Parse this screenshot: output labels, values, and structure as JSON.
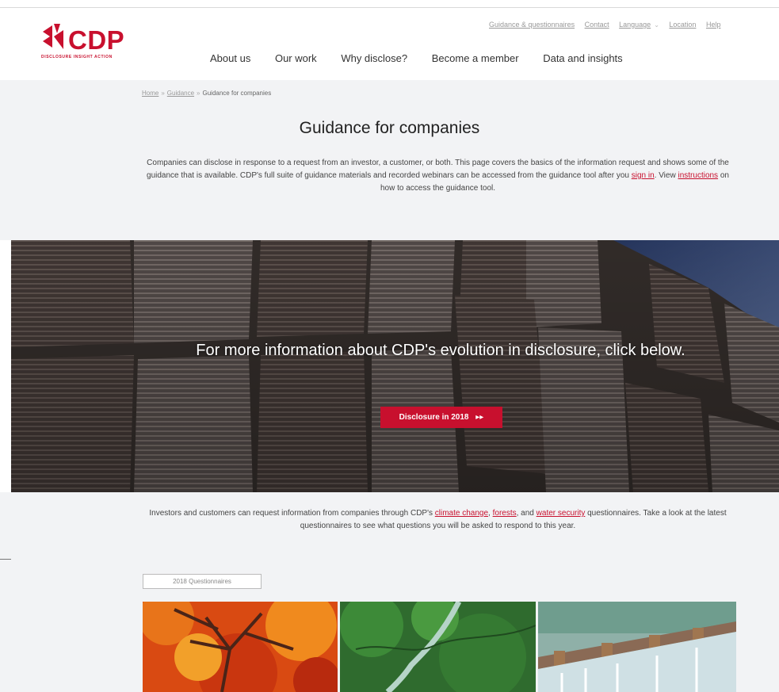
{
  "header": {
    "logo_word": "CDP",
    "logo_tagline": "DISCLOSURE INSIGHT ACTION",
    "utility_links": [
      "Guidance & questionnaires",
      "Contact",
      "Language",
      "Location",
      "Help"
    ],
    "main_nav": [
      "About us",
      "Our work",
      "Why disclose?",
      "Become a member",
      "Data and insights"
    ]
  },
  "breadcrumb": {
    "home": "Home",
    "guidance": "Guidance",
    "current": "Guidance for companies",
    "separator": "»"
  },
  "page": {
    "title": "Guidance for companies",
    "intro_before": "Companies can disclose in response to a request from an investor, a customer, or both. This page covers the basics of the information request and shows some of the guidance that is available. CDP's full suite of guidance materials and recorded webinars can be accessed from the guidance tool after you ",
    "intro_link1": "sign in",
    "intro_mid": ". View ",
    "intro_link2": "instructions",
    "intro_after": " on how to access the guidance tool."
  },
  "hero": {
    "heading": "For more information about CDP's evolution in disclosure, click below.",
    "button_label": "Disclosure in 2018",
    "button_icon": "double-chevron-right-icon",
    "button_glyph": "▸▸"
  },
  "lower": {
    "text_before": "Investors and customers can request information from companies through CDP's ",
    "link1": "climate change",
    "sep1": ", ",
    "link2": "forests",
    "sep2": ", and ",
    "link3": "water security",
    "text_after": " questionnaires. Take a look at the latest questionnaires to see what questions you will be asked to respond to this year.",
    "tab_label": "2018 Questionnaires"
  },
  "colors": {
    "brand": "#c8102e",
    "background": "#f2f3f5"
  }
}
